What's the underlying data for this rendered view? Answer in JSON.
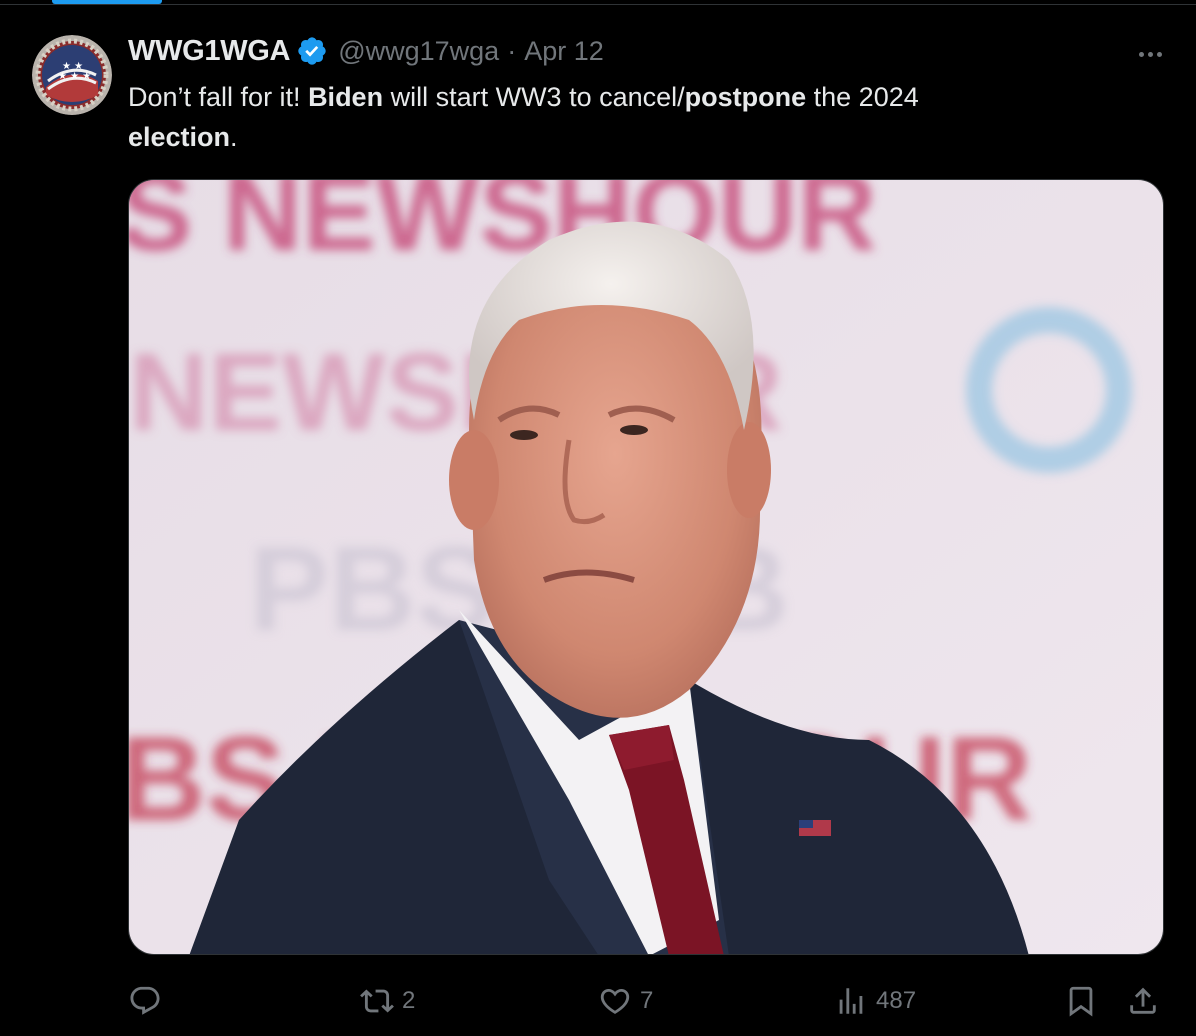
{
  "author": {
    "display_name": "WWG1WGA",
    "handle": "@wwg17wga",
    "separator": "·",
    "date": "Apr 12",
    "verified": true,
    "avatar_text": "WHERE WE GO ONE WE GO ALL"
  },
  "tweet": {
    "text_parts": [
      {
        "text": "Don’t fall for it! ",
        "bold": false
      },
      {
        "text": "Biden",
        "bold": true
      },
      {
        "text": " will start WW3 to cancel/",
        "bold": false
      },
      {
        "text": "postpone",
        "bold": true
      },
      {
        "text": " the 2024 ",
        "bold": false
      },
      {
        "text": "election",
        "bold": true
      },
      {
        "text": ".",
        "bold": false
      }
    ]
  },
  "media": {
    "alt": "Photo of Joe Biden at a PBS NewsHour debate backdrop",
    "backdrop_text": {
      "row1": "S NEWSHOUR",
      "row2": "NEWSHOUR",
      "row3": "PBS OPB",
      "row4": "BS NEWSHOUR"
    }
  },
  "actions": {
    "reply": {
      "icon": "reply-icon",
      "count": ""
    },
    "repost": {
      "icon": "repost-icon",
      "count": "2"
    },
    "like": {
      "icon": "heart-icon",
      "count": "7"
    },
    "views": {
      "icon": "views-icon",
      "count": "487"
    },
    "bookmark": {
      "icon": "bookmark-icon"
    },
    "share": {
      "icon": "share-icon"
    }
  },
  "colors": {
    "background": "#000000",
    "text_primary": "#e7e9ea",
    "text_secondary": "#71767b",
    "verified_blue": "#1d9bf0",
    "border": "#2f3336"
  }
}
